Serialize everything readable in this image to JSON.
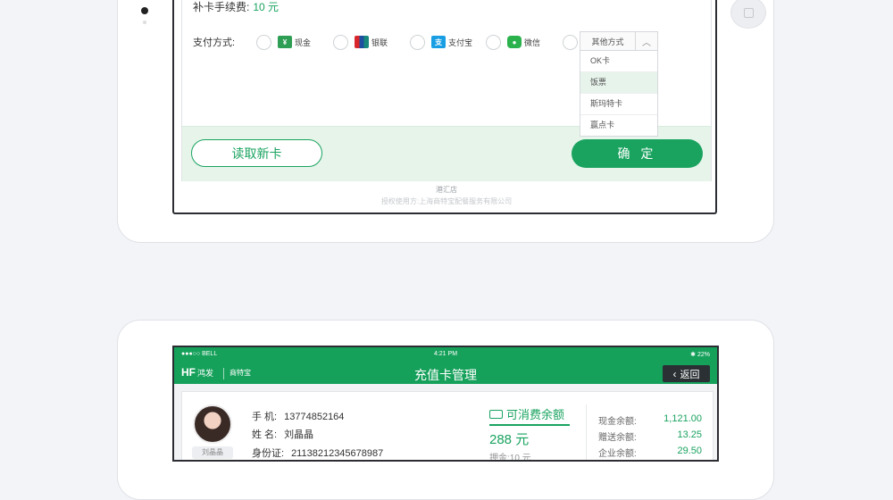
{
  "top_screen": {
    "fee_label": "补卡手续费:",
    "fee_value": "10 元",
    "pay_label": "支付方式:",
    "payment_methods": [
      {
        "label": "现金",
        "icon": "cash-icon"
      },
      {
        "label": "银联",
        "icon": "unionpay-icon"
      },
      {
        "label": "支付宝",
        "icon": "alipay-icon"
      },
      {
        "label": "微信",
        "icon": "wechat-icon"
      }
    ],
    "other_dropdown": {
      "label": "其他方式",
      "options": [
        "OK卡",
        "饭票",
        "斯玛特卡",
        "赢点卡"
      ],
      "highlighted": "饭票"
    },
    "read_card_button": "读取新卡",
    "confirm_button": "确 定",
    "footer_store": "港汇店",
    "footer_copyright": "授权使用方:上海商特宝配餐服务有限公司"
  },
  "bottom_screen": {
    "status": {
      "carrier": "●●●○○ BELL",
      "time": "4:21 PM",
      "battery": "✱ 22%"
    },
    "logo_main": "HF",
    "logo_sub": "鸿发",
    "logo_partner": "商特宝",
    "nav_title": "充值卡管理",
    "back_button": "返回",
    "member": {
      "nickname": "刘晶晶",
      "phone_label": "手  机:",
      "phone": "13774852164",
      "name_label": "姓  名:",
      "name": "刘晶晶",
      "id_label": "身份证:",
      "id": "21138212345678987"
    },
    "balance": {
      "title": "可消费余额",
      "value": "288 元",
      "deposit": "押金:10 元"
    },
    "right_balances": [
      {
        "label": "现金余额:",
        "value": "1,121.00"
      },
      {
        "label": "赠送余额:",
        "value": "13.25"
      },
      {
        "label": "企业余额:",
        "value": "29.50"
      }
    ]
  }
}
